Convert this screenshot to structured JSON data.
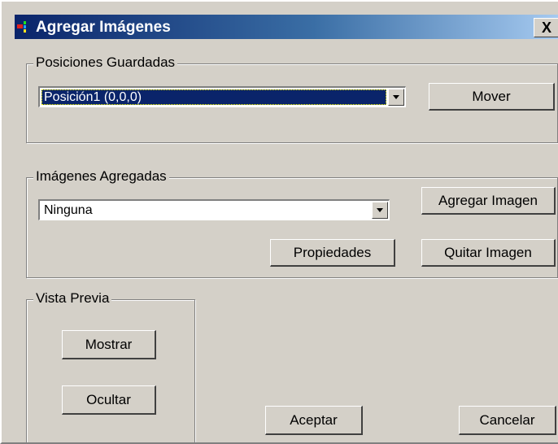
{
  "window": {
    "title": "Agregar Imágenes",
    "close_label": "X",
    "icon": "app-icon"
  },
  "saved_positions": {
    "group_label": "Posiciones Guardadas",
    "selected_value": "Posición1 (0,0,0)",
    "move_button": "Mover"
  },
  "added_images": {
    "group_label": "Imágenes Agregadas",
    "selected_value": "Ninguna",
    "add_button": "Agregar Imagen",
    "properties_button": "Propiedades",
    "remove_button": "Quitar Imagen"
  },
  "preview": {
    "group_label": "Vista Previa",
    "show_button": "Mostrar",
    "hide_button": "Ocultar"
  },
  "footer": {
    "accept_button": "Aceptar",
    "cancel_button": "Cancelar"
  },
  "colors": {
    "title_gradient_start": "#0a246a",
    "title_gradient_end": "#a6caf0",
    "face": "#d4d0c8",
    "selection": "#0a246a"
  }
}
